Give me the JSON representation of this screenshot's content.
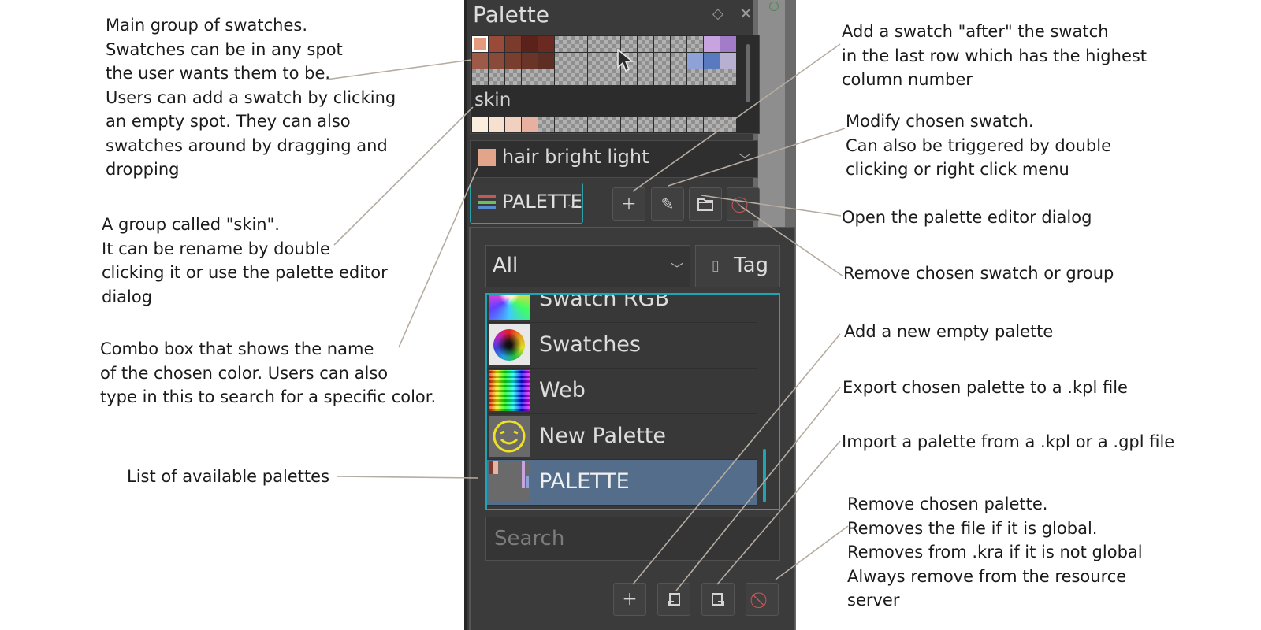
{
  "panel": {
    "title": "Palette",
    "group_name": "skin",
    "chosen_color": "hair bright light",
    "chosen_color_hex": "#e3a58a",
    "palette_button": "PALETTE",
    "filter": "All",
    "tag_button": "Tag",
    "search_placeholder": "Search",
    "palettes": [
      {
        "name": "Swatch RGB",
        "icon": "rgb-wheel-thumb"
      },
      {
        "name": "Swatches",
        "icon": "color-wheel-thumb"
      },
      {
        "name": "Web",
        "icon": "web-grid-thumb"
      },
      {
        "name": "New Palette",
        "icon": "smiley-thumb"
      },
      {
        "name": "PALETTE",
        "icon": "palette-thumb",
        "selected": true
      }
    ],
    "main_swatches": [
      [
        "#e49a7e",
        "#9a4a38",
        "#7a3a2c",
        "#5a221a",
        "#6a2a22",
        "",
        "",
        "",
        "",
        "",
        "",
        "",
        "",
        "",
        "#c7a3e0",
        "#a27cc8"
      ],
      [
        "#9e5a48",
        "#8a4a3a",
        "#7a3e2e",
        "#6a3428",
        "#5e2e24",
        "",
        "",
        "",
        "",
        "",
        "",
        "",
        "",
        "#8ea2d8",
        "#5a7ac0",
        "#b8b0d0"
      ],
      [
        "",
        "",
        "",
        "",
        "",
        "",
        "",
        "",
        "",
        "",
        "",
        "",
        "",
        "",
        "",
        ""
      ]
    ],
    "skin_swatches": [
      "#fbeedc",
      "#f6e0d0",
      "#f2d0c0",
      "#e8b0a0",
      "",
      "",
      "",
      "",
      "",
      "",
      "",
      "",
      "",
      "",
      "",
      ""
    ],
    "swatch_toolbar_icons": [
      "plus-icon",
      "pencil-icon",
      "folder-icon",
      "no-entry-icon"
    ],
    "palette_toolbar_icons": [
      "plus-icon",
      "export-icon",
      "import-icon",
      "no-entry-icon"
    ]
  },
  "annotations": {
    "main_group": "Main group of swatches.\nSwatches can be in any spot\nthe user wants them to be.\nUsers can add a swatch by clicking\nan empty spot. They can also\nswatches around by dragging and\ndropping",
    "skin_group": "A group called \"skin\".\nIt can be rename by double\nclicking it or use the palette editor\ndialog",
    "combo_box": "Combo box that shows the name\nof the chosen color. Users can also\ntype in this to search for a specific color.",
    "list_palettes": "List of available palettes",
    "add_swatch": "Add a swatch \"after\" the swatch\nin the last row which has the highest\ncolumn number",
    "modify_swatch": "Modify chosen swatch.\nCan also be triggered by double\nclicking or right click menu",
    "open_editor": "Open the palette editor dialog",
    "remove_swatch": "Remove chosen swatch or group",
    "add_palette": "Add a new empty palette",
    "export_palette": "Export chosen palette to a .kpl file",
    "import_palette": "Import a palette from a .kpl or a .gpl file",
    "remove_palette": "Remove chosen palette.\nRemoves the file if it is global.\nRemoves from .kra if it is not global\nAlways remove from the resource\nserver"
  },
  "colors": {
    "accent": "#1fa4b4",
    "selection": "#536d8b",
    "leader_line": "#b5aca2",
    "remove": "#c25959"
  }
}
